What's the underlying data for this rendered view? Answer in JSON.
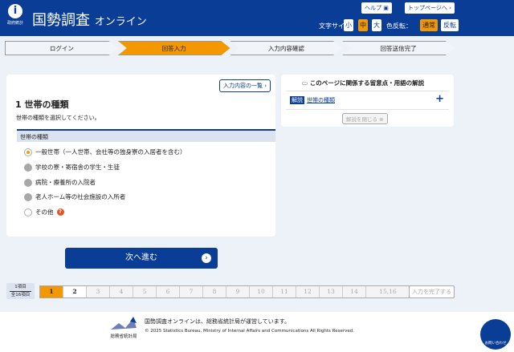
{
  "header": {
    "logo_caption": "政府統計",
    "title": "国勢調査",
    "title_sub": "オンライン",
    "help": "ヘルプ",
    "top_page": "トップページへ",
    "font_size_label": "文字サイズ：",
    "sizes": [
      "小",
      "中",
      "大"
    ],
    "color_label": "色反転：",
    "color_modes": [
      "通常",
      "反転"
    ]
  },
  "steps": [
    "ログイン",
    "回答入力",
    "入力内容確認",
    "回答送信完了"
  ],
  "main": {
    "list_button": "入力内容の一覧",
    "heading": "1 世帯の種類",
    "instruction": "世帯の種類を選択してください。",
    "field_label": "世帯の種類",
    "options": [
      "一般世帯（一人世帯、会社等の独身寮の入居者を含む）",
      "学校の寮・寄宿舎の学生・生徒",
      "病院・療養所の入院者",
      "老人ホーム等の社会施設の入所者",
      "その他"
    ],
    "help_mark": "?"
  },
  "notes": {
    "title": "このページに関係する留意点・用語の解説",
    "tag": "解説",
    "link": "世帯の種類",
    "expand": "+",
    "close": "解説を閉じる"
  },
  "next_button": "次へ進む",
  "pager": {
    "current": "1項目",
    "total": "全16項目",
    "pages": [
      "1",
      "2",
      "3",
      "4",
      "5",
      "6",
      "7",
      "8",
      "9",
      "10",
      "11",
      "12",
      "13",
      "14",
      "15,16"
    ],
    "finish": "入力を完了する"
  },
  "footer": {
    "org": "総務省統計局",
    "notice": "国勢調査オンラインは、総務省統計局が運営しています。",
    "copyright": "© 2025 Statistics Bureau, Ministry of Internal Affairs and Communications All Rights Reserved.",
    "contact": "お問い合わせ"
  },
  "colors": {
    "primary": "#0a3d96",
    "accent": "#f39800"
  }
}
